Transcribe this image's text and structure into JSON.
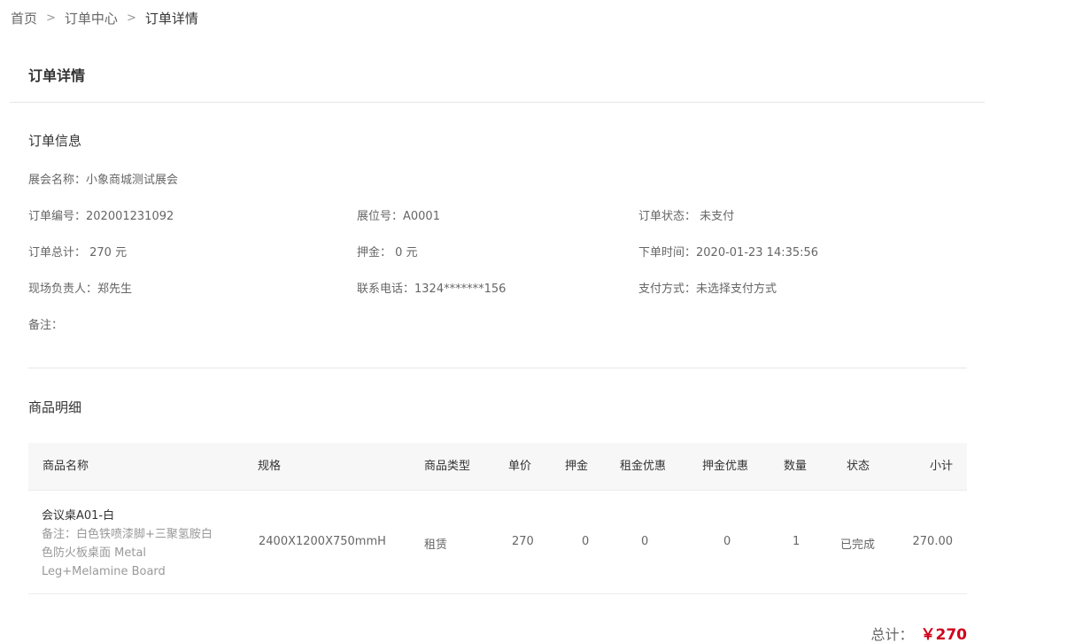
{
  "breadcrumb": {
    "items": [
      "首页",
      "订单中心",
      "订单详情"
    ],
    "separator": ">"
  },
  "page_title": "订单详情",
  "order_info": {
    "section_title": "订单信息",
    "expo_name": "展会名称：小象商城测试展会",
    "order_no": "订单编号：202001231092",
    "booth_no": "展位号：A0001",
    "order_status": "订单状态： 未支付",
    "order_total": "订单总计： 270 元",
    "deposit": "押金： 0 元",
    "order_time": "下单时间：2020-01-23 14:35:56",
    "site_manager": "现场负责人：郑先生",
    "phone": "联系电话：1324*******156",
    "pay_method": "支付方式：未选择支付方式",
    "remark": "备注："
  },
  "product_detail": {
    "section_title": "商品明细",
    "columns": [
      "商品名称",
      "规格",
      "商品类型",
      "单价",
      "押金",
      "租金优惠",
      "押金优惠",
      "数量",
      "状态",
      "小计"
    ],
    "rows": [
      {
        "name": "会议桌A01-白",
        "note": "备注：白色铁喷漆脚+三聚氢胺白色防火板桌面 Metal Leg+Melamine Board",
        "spec": "2400X1200X750mmH",
        "type": "租赁",
        "unit_price": "270",
        "deposit": "0",
        "rent_discount": "0",
        "deposit_discount": "0",
        "qty": "1",
        "status": "已完成",
        "subtotal": "270.00"
      }
    ]
  },
  "total": {
    "label": "总计：",
    "amount": "￥270"
  },
  "colors": {
    "accent_price": "#d0021b",
    "divider": "#e6e6e6",
    "table_header_bg": "#f7f7f7"
  }
}
